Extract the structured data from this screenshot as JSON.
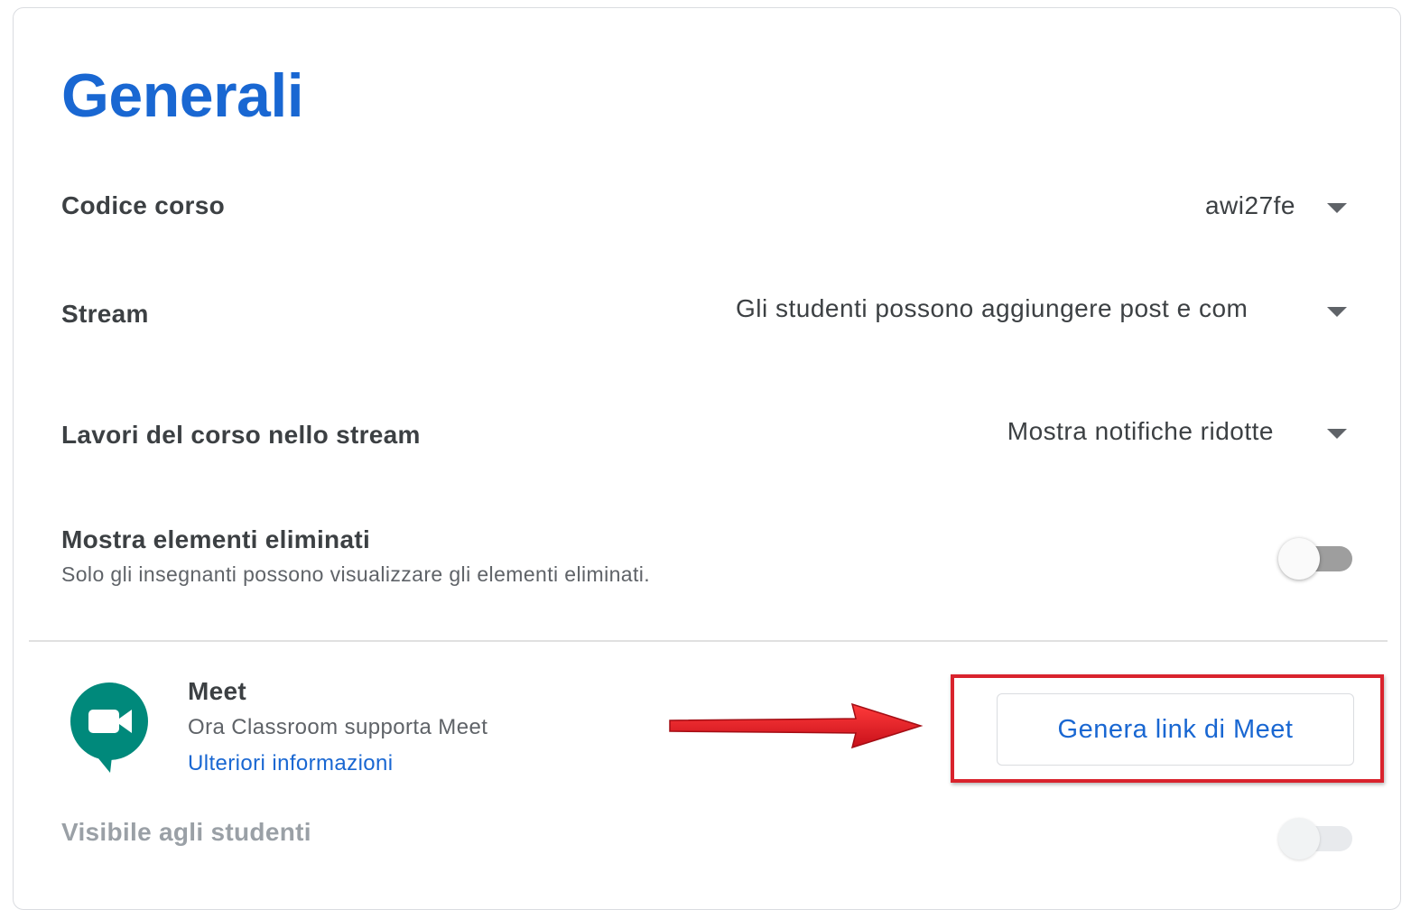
{
  "section": {
    "title": "Generali"
  },
  "settings": {
    "course_code": {
      "label": "Codice corso",
      "value": "awi27fe"
    },
    "stream": {
      "label": "Stream",
      "value": "Gli studenti possono aggiungere post e com"
    },
    "classwork_on_stream": {
      "label": "Lavori del corso nello stream",
      "value": "Mostra notifiche ridotte"
    },
    "show_deleted": {
      "label": "Mostra elementi eliminati",
      "description": "Solo gli insegnanti possono visualizzare gli elementi eliminati.",
      "enabled": false
    }
  },
  "meet": {
    "title": "Meet",
    "subtitle": "Ora Classroom supporta Meet",
    "learn_more": "Ulteriori informazioni",
    "generate_button": "Genera link di Meet",
    "visible_label": "Visibile agli studenti",
    "visible_enabled": false
  },
  "colors": {
    "accent": "#1967d2",
    "annotation_red": "#d9232d",
    "meet_green": "#00897b"
  },
  "icons": {
    "dropdown": "caret-down-icon",
    "meet": "google-meet-logo-icon",
    "annotation": "red-arrow-annotation"
  }
}
